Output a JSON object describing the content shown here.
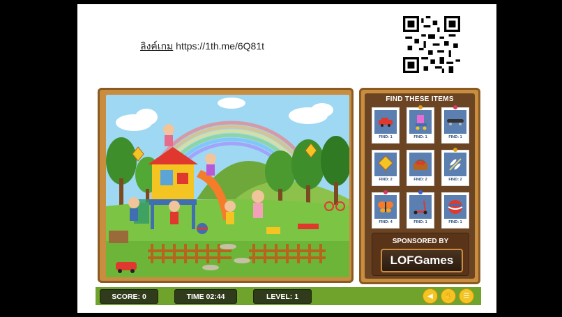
{
  "slide": {
    "link_prefix": "ลิงค์เกม",
    "link_url": "https://1th.me/6Q81t"
  },
  "panel": {
    "title": "FIND THESE ITEMS",
    "items": [
      {
        "name": "car",
        "find": "FIND: 1",
        "pin": "",
        "icon": "car-icon"
      },
      {
        "name": "roller-skate",
        "find": "FIND: 1",
        "pin": "#e2a11a",
        "icon": "roller-skate-icon"
      },
      {
        "name": "skateboard",
        "find": "FIND: 1",
        "pin": "#d63a6a",
        "icon": "skateboard-icon"
      },
      {
        "name": "kite",
        "find": "FIND: 2",
        "pin": "",
        "icon": "kite-icon"
      },
      {
        "name": "picnic-basket",
        "find": "FIND: 2",
        "pin": "",
        "icon": "basket-icon"
      },
      {
        "name": "dragonfly",
        "find": "FIND: 2",
        "pin": "#e2a11a",
        "icon": "dragonfly-icon"
      },
      {
        "name": "butterfly",
        "find": "FIND: 4",
        "pin": "#d63a6a",
        "icon": "butterfly-icon"
      },
      {
        "name": "scooter",
        "find": "FIND: 1",
        "pin": "#3a5fd6",
        "icon": "scooter-icon"
      },
      {
        "name": "ball",
        "find": "FIND: 1",
        "pin": "",
        "icon": "ball-icon"
      }
    ],
    "sponsor_label": "SPONSORED BY",
    "sponsor_logo": "LOFGames"
  },
  "status": {
    "score": "SCORE: 0",
    "time": "TIME 02:44",
    "level": "LEVEL: 1"
  },
  "buttons": [
    {
      "name": "sound-button",
      "icon": "speaker-icon",
      "glyph": "◀"
    },
    {
      "name": "hint-button",
      "icon": "hand-icon",
      "glyph": "✋"
    },
    {
      "name": "menu-button",
      "icon": "menu-icon",
      "glyph": "☰"
    }
  ],
  "colors": {
    "sky": "#9fd8f2",
    "grass": "#7cc443",
    "frame": "#c98d40",
    "panel_bg": "#6b4423",
    "card_bg": "#5a7fb0",
    "status_bar": "#6fa32c",
    "button": "#f3c422"
  }
}
